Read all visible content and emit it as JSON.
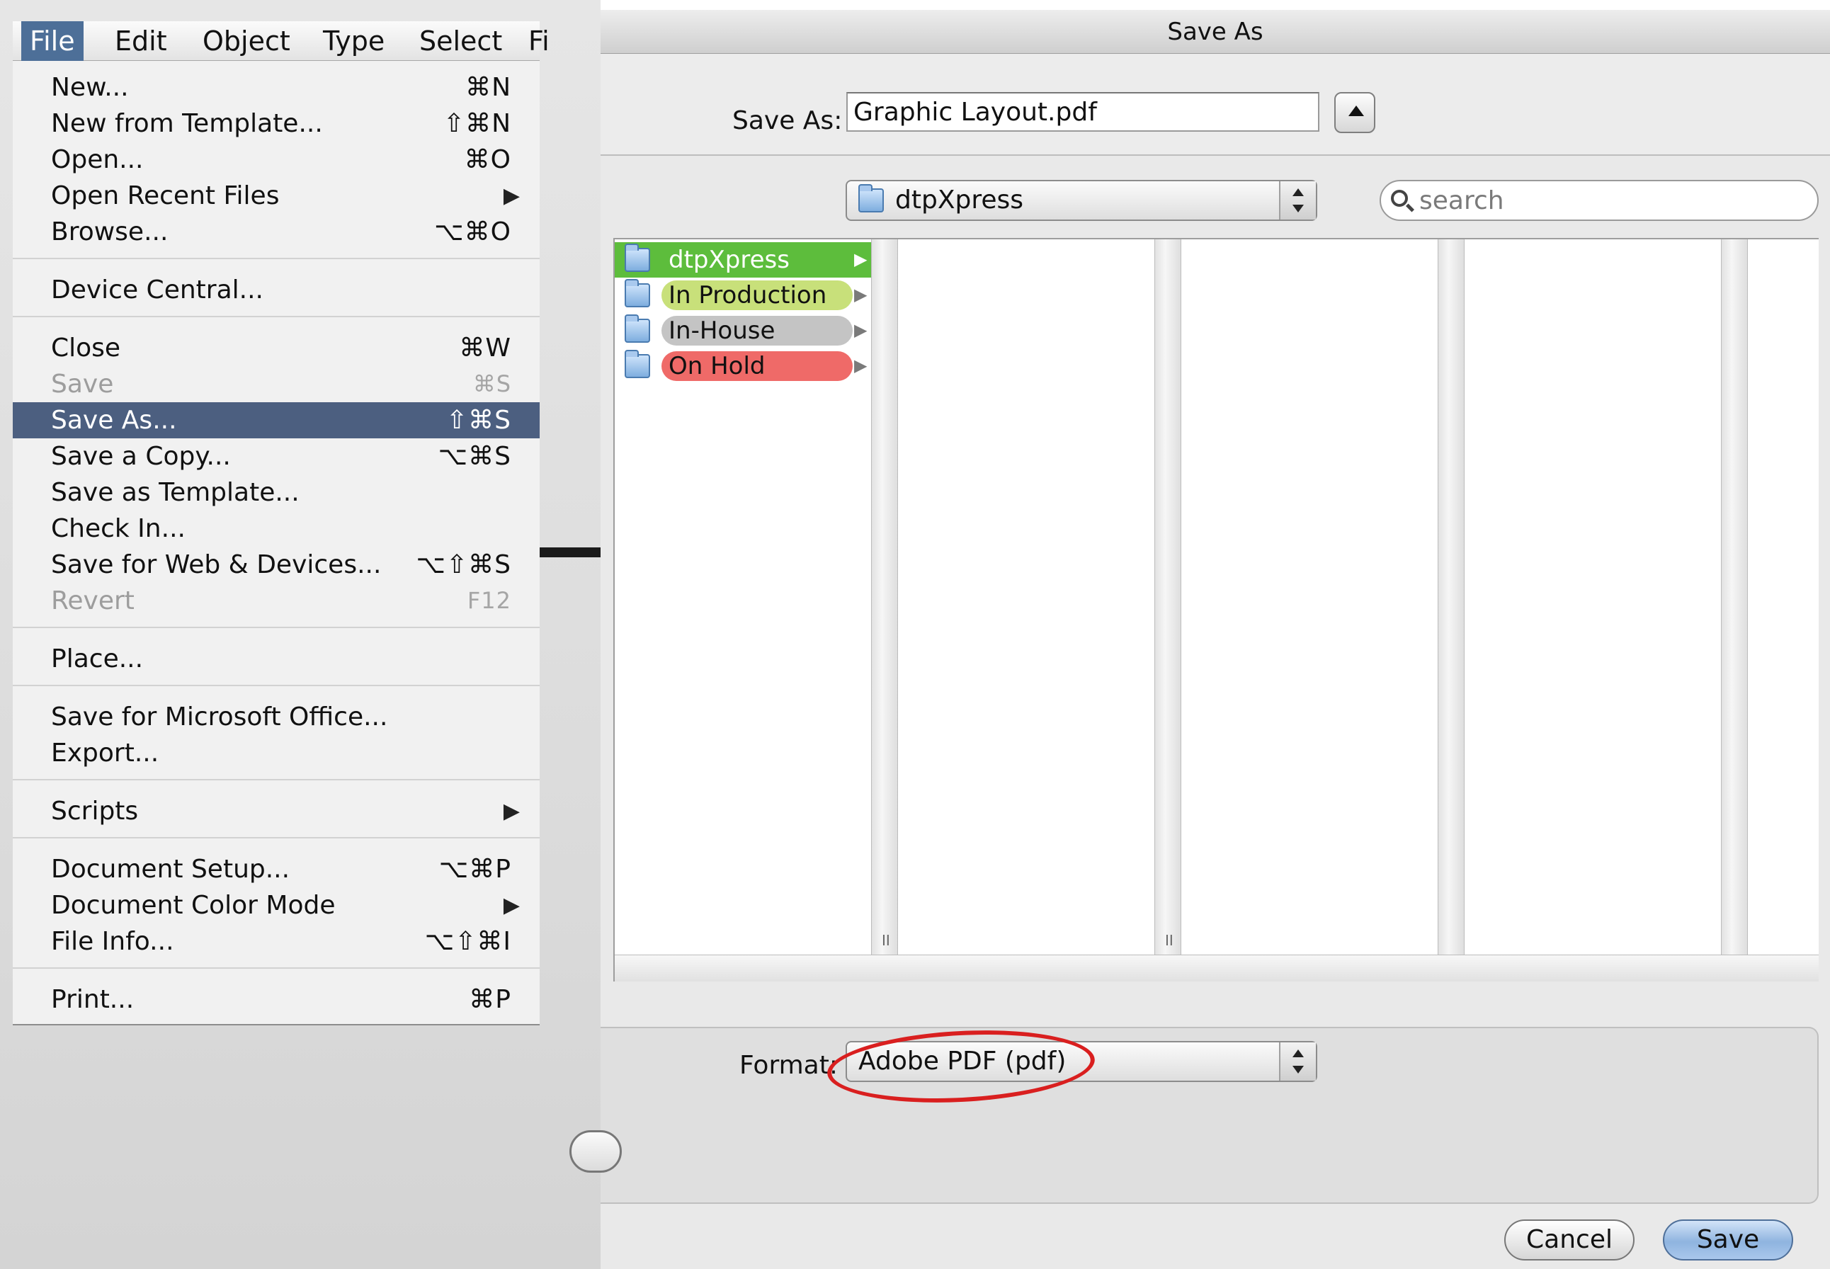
{
  "menubar": {
    "items": [
      "File",
      "Edit",
      "Object",
      "Type",
      "Select",
      "Fi"
    ]
  },
  "file_menu": {
    "items": [
      {
        "label": "New...",
        "shortcut": "⌘N"
      },
      {
        "label": "New from Template...",
        "shortcut": "⇧⌘N"
      },
      {
        "label": "Open...",
        "shortcut": "⌘O"
      },
      {
        "label": "Open Recent Files",
        "submenu": "▶"
      },
      {
        "label": "Browse...",
        "shortcut": "⌥⌘O"
      },
      {
        "label": "Device Central..."
      },
      {
        "label": "Close",
        "shortcut": "⌘W"
      },
      {
        "label": "Save",
        "shortcut": "⌘S",
        "disabled": true
      },
      {
        "label": "Save As...",
        "shortcut": "⇧⌘S",
        "highlighted": true
      },
      {
        "label": "Save a Copy...",
        "shortcut": "⌥⌘S"
      },
      {
        "label": "Save as Template..."
      },
      {
        "label": "Check In..."
      },
      {
        "label": "Save for Web & Devices...",
        "shortcut": "⌥⇧⌘S"
      },
      {
        "label": "Revert",
        "shortcut": "F12",
        "disabled": true
      },
      {
        "label": "Place..."
      },
      {
        "label": "Save for Microsoft Office..."
      },
      {
        "label": "Export..."
      },
      {
        "label": "Scripts",
        "submenu": "▶"
      },
      {
        "label": "Document Setup...",
        "shortcut": "⌥⌘P"
      },
      {
        "label": "Document Color Mode",
        "submenu": "▶"
      },
      {
        "label": "File Info...",
        "shortcut": "⌥⇧⌘I"
      },
      {
        "label": "Print...",
        "shortcut": "⌘P"
      }
    ]
  },
  "dialog": {
    "title": "Save As",
    "save_as_label": "Save As:",
    "filename": "Graphic Layout.pdf",
    "location": "dtpXpress",
    "search_placeholder": "search",
    "folders": [
      {
        "name": "dtpXpress",
        "color": "#5dbd3c",
        "selected": true
      },
      {
        "name": "In Production",
        "color": "#c8e07a"
      },
      {
        "name": "In-House",
        "color": "#c4c4c4"
      },
      {
        "name": "On Hold",
        "color": "#ef6a68"
      }
    ],
    "arrow_glyph": "▶",
    "grip_glyph": "II",
    "format_label": "Format:",
    "format_value": "Adobe PDF (pdf)",
    "cancel_label": "Cancel",
    "save_label": "Save"
  },
  "colors": {
    "menu_highlight": "#4c5f80",
    "annotation_circle": "#d91f1f"
  }
}
